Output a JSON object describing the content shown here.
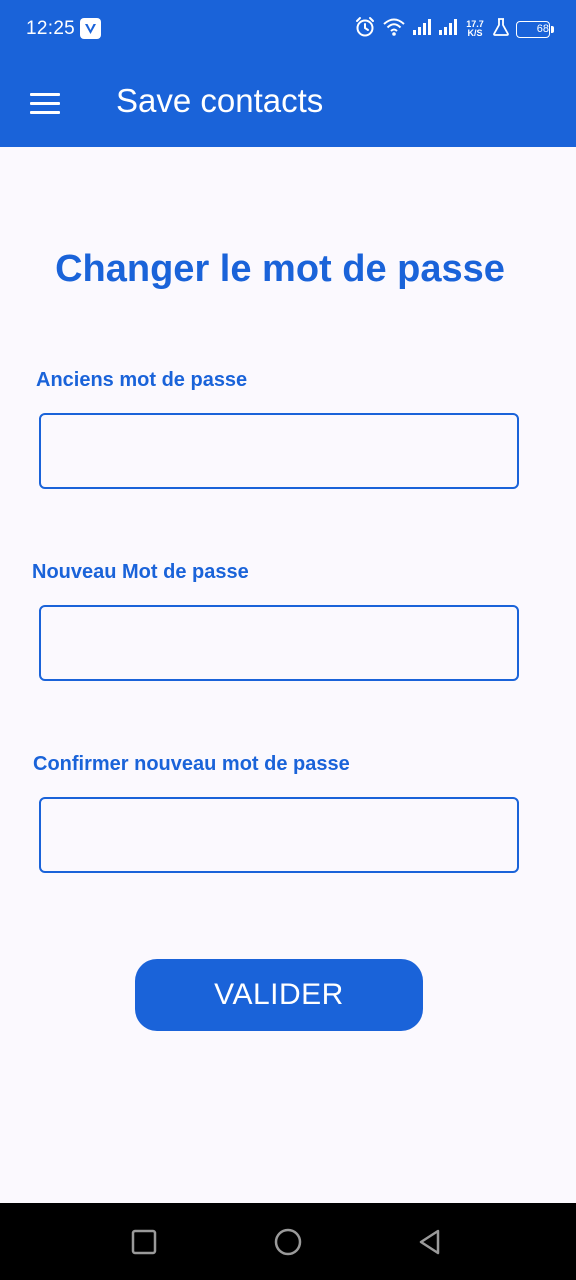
{
  "status_bar": {
    "time": "12:25",
    "network_speed_value": "17.7",
    "network_speed_unit": "K/S",
    "battery_level": "68",
    "icons": [
      "vpn-icon",
      "alarm-icon",
      "wifi-icon",
      "signal-icon",
      "signal-icon",
      "flask-icon",
      "battery-icon"
    ]
  },
  "app_bar": {
    "title": "Save contacts",
    "menu_icon": "hamburger-menu-icon"
  },
  "page": {
    "title": "Changer le mot de passe",
    "fields": [
      {
        "label": "Anciens mot de passe",
        "value": "",
        "placeholder": ""
      },
      {
        "label": "Nouveau Mot de passe",
        "value": "",
        "placeholder": ""
      },
      {
        "label": "Confirmer nouveau mot de passe",
        "value": "",
        "placeholder": ""
      }
    ],
    "submit_label": "VALIDER"
  },
  "nav_bar": {
    "buttons": [
      "recent-apps-icon",
      "home-icon",
      "back-icon"
    ]
  },
  "colors": {
    "primary": "#1a63d9",
    "background": "#fbf9fe",
    "nav_background": "#000000"
  }
}
